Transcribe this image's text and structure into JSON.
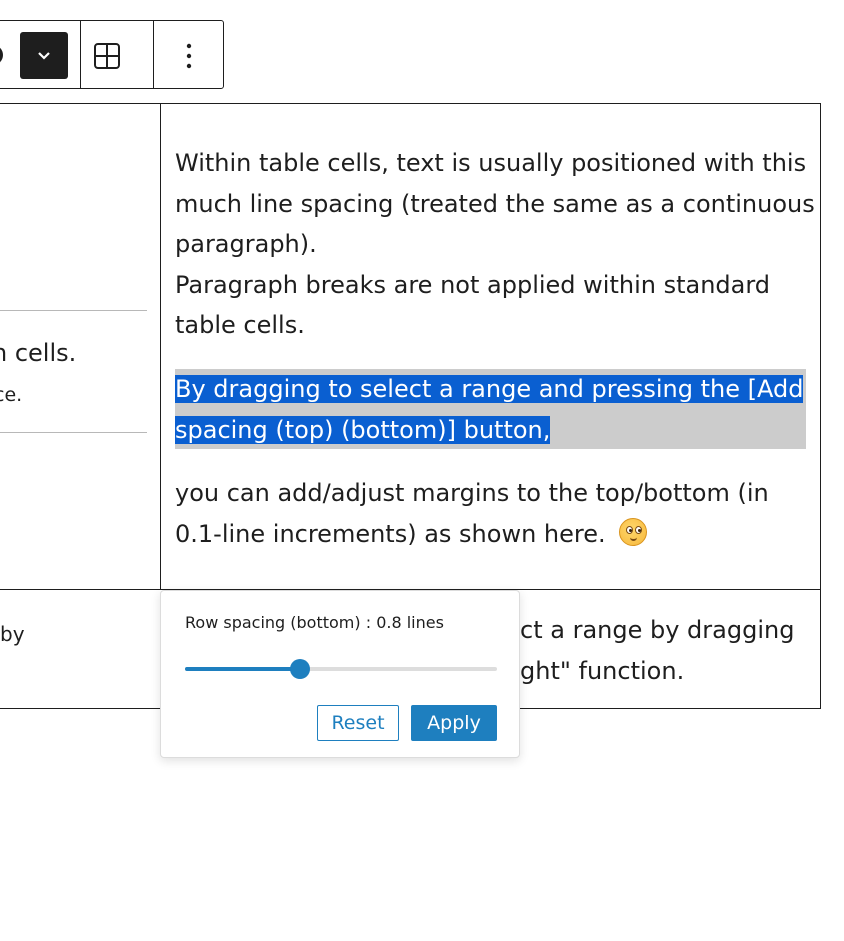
{
  "colors": {
    "accent": "#1e7fbf",
    "selection": "#0a5fd1",
    "selection_line": "#cccccc",
    "text": "#1e1e1e"
  },
  "toolbar": {
    "partial_icon": "align-icon",
    "dropdown_icon": "chevron-down-icon",
    "table_icon": "table-grid-icon",
    "more_icon": "more-vertical-icon"
  },
  "table": {
    "right_cell": {
      "lines": [
        "Within table cells, text is usually positioned with this",
        "much line spacing (treated the same as a continuous",
        "paragraph).",
        "Paragraph breaks are not applied within standard",
        "table cells."
      ],
      "selected_lines": [
        "By dragging to select a range and pressing the [Add",
        "spacing (top) (bottom)] button,"
      ],
      "after_lines": [
        "you can add/adjust margins to the top/bottom (in",
        "0.1-line increments) as shown here."
      ],
      "emoji": "smiling-face-emoji"
    },
    "left_cell_fragments": {
      "line1": "n cells.",
      "line2": "ce."
    },
    "bottom_row": {
      "left_fragment": "by",
      "right_line1": "ct a range by dragging",
      "right_line2": "ght\" function."
    }
  },
  "popover": {
    "label": "Row spacing (bottom) : 0.8 lines",
    "slider_value": 0.37,
    "reset_label": "Reset",
    "apply_label": "Apply"
  }
}
